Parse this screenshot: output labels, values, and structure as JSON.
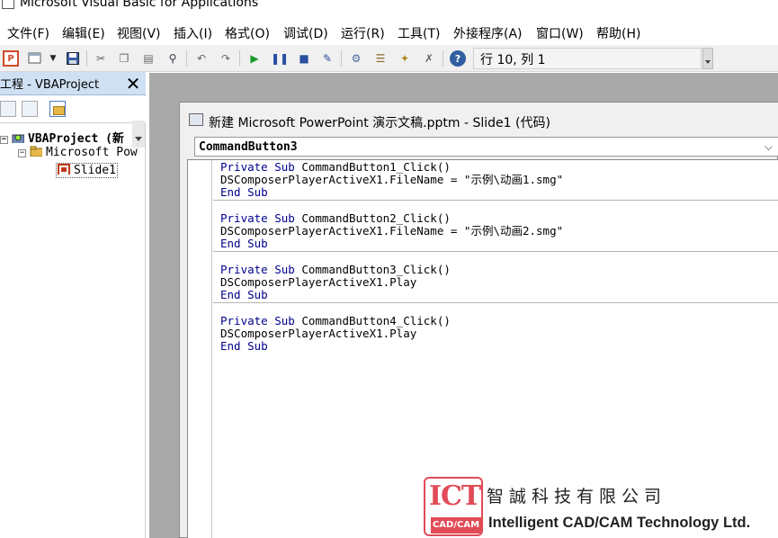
{
  "window": {
    "title": "Microsoft Visual Basic for Applications"
  },
  "menu": {
    "items": [
      {
        "label": "文件(F)"
      },
      {
        "label": "编辑(E)"
      },
      {
        "label": "视图(V)"
      },
      {
        "label": "插入(I)"
      },
      {
        "label": "格式(O)"
      },
      {
        "label": "调试(D)"
      },
      {
        "label": "运行(R)"
      },
      {
        "label": "工具(T)"
      },
      {
        "label": "外接程序(A)"
      },
      {
        "label": "窗口(W)"
      },
      {
        "label": "帮助(H)"
      }
    ]
  },
  "toolbar": {
    "cursor_position": "行 10, 列 1",
    "icons": [
      "powerpoint-icon",
      "insert-userform-icon",
      "save-icon",
      "cut-icon",
      "copy-icon",
      "paste-icon",
      "find-icon",
      "undo-icon",
      "redo-icon",
      "run-icon",
      "break-icon",
      "reset-icon",
      "design-mode-icon",
      "project-explorer-icon",
      "properties-icon",
      "object-browser-icon",
      "toolbox-icon",
      "help-icon"
    ]
  },
  "project": {
    "pane_title": "工程 - VBAProject",
    "tree": {
      "root": "VBAProject (新",
      "child": "Microsoft Pow",
      "leaf": "Slide1"
    }
  },
  "code_window": {
    "title": "新建 Microsoft PowerPoint 演示文稿.pptm - Slide1 (代码)",
    "object_combo": "CommandButton3",
    "procedures": [
      {
        "lines": [
          {
            "kw1": "Private",
            "kw2": "Sub",
            "text": " CommandButton1_Click()"
          },
          {
            "kw1": "",
            "kw2": "",
            "text": "DSComposerPlayerActiveX1.FileName = \"示例\\动画1.smg\""
          },
          {
            "kw1": "End",
            "kw2": "Sub",
            "text": ""
          }
        ]
      },
      {
        "lines": [
          {
            "kw1": "Private",
            "kw2": "Sub",
            "text": " CommandButton2_Click()"
          },
          {
            "kw1": "",
            "kw2": "",
            "text": "DSComposerPlayerActiveX1.FileName = \"示例\\动画2.smg\""
          },
          {
            "kw1": "End",
            "kw2": "Sub",
            "text": ""
          }
        ]
      },
      {
        "lines": [
          {
            "kw1": "Private",
            "kw2": "Sub",
            "text": " CommandButton3_Click()"
          },
          {
            "kw1": "",
            "kw2": "",
            "text": "DSComposerPlayerActiveX1.Play"
          },
          {
            "kw1": "End",
            "kw2": "Sub",
            "text": ""
          }
        ]
      },
      {
        "lines": [
          {
            "kw1": "Private",
            "kw2": "Sub",
            "text": " CommandButton4_Click()"
          },
          {
            "kw1": "",
            "kw2": "",
            "text": "DSComposerPlayerActiveX1.Play"
          },
          {
            "kw1": "End",
            "kw2": "Sub",
            "text": ""
          }
        ]
      }
    ]
  },
  "watermark": {
    "logo_text": "ICT",
    "logo_sub": "CAD/CAM",
    "company_cn": "智誠科技有限公司",
    "company_en": "Intelligent CAD/CAM Technology Ltd."
  },
  "colors": {
    "keyword": "#00008b",
    "logo_red": "#e14b57",
    "mdi_background": "#a9a9a9",
    "project_header": "#cfe0f3"
  }
}
